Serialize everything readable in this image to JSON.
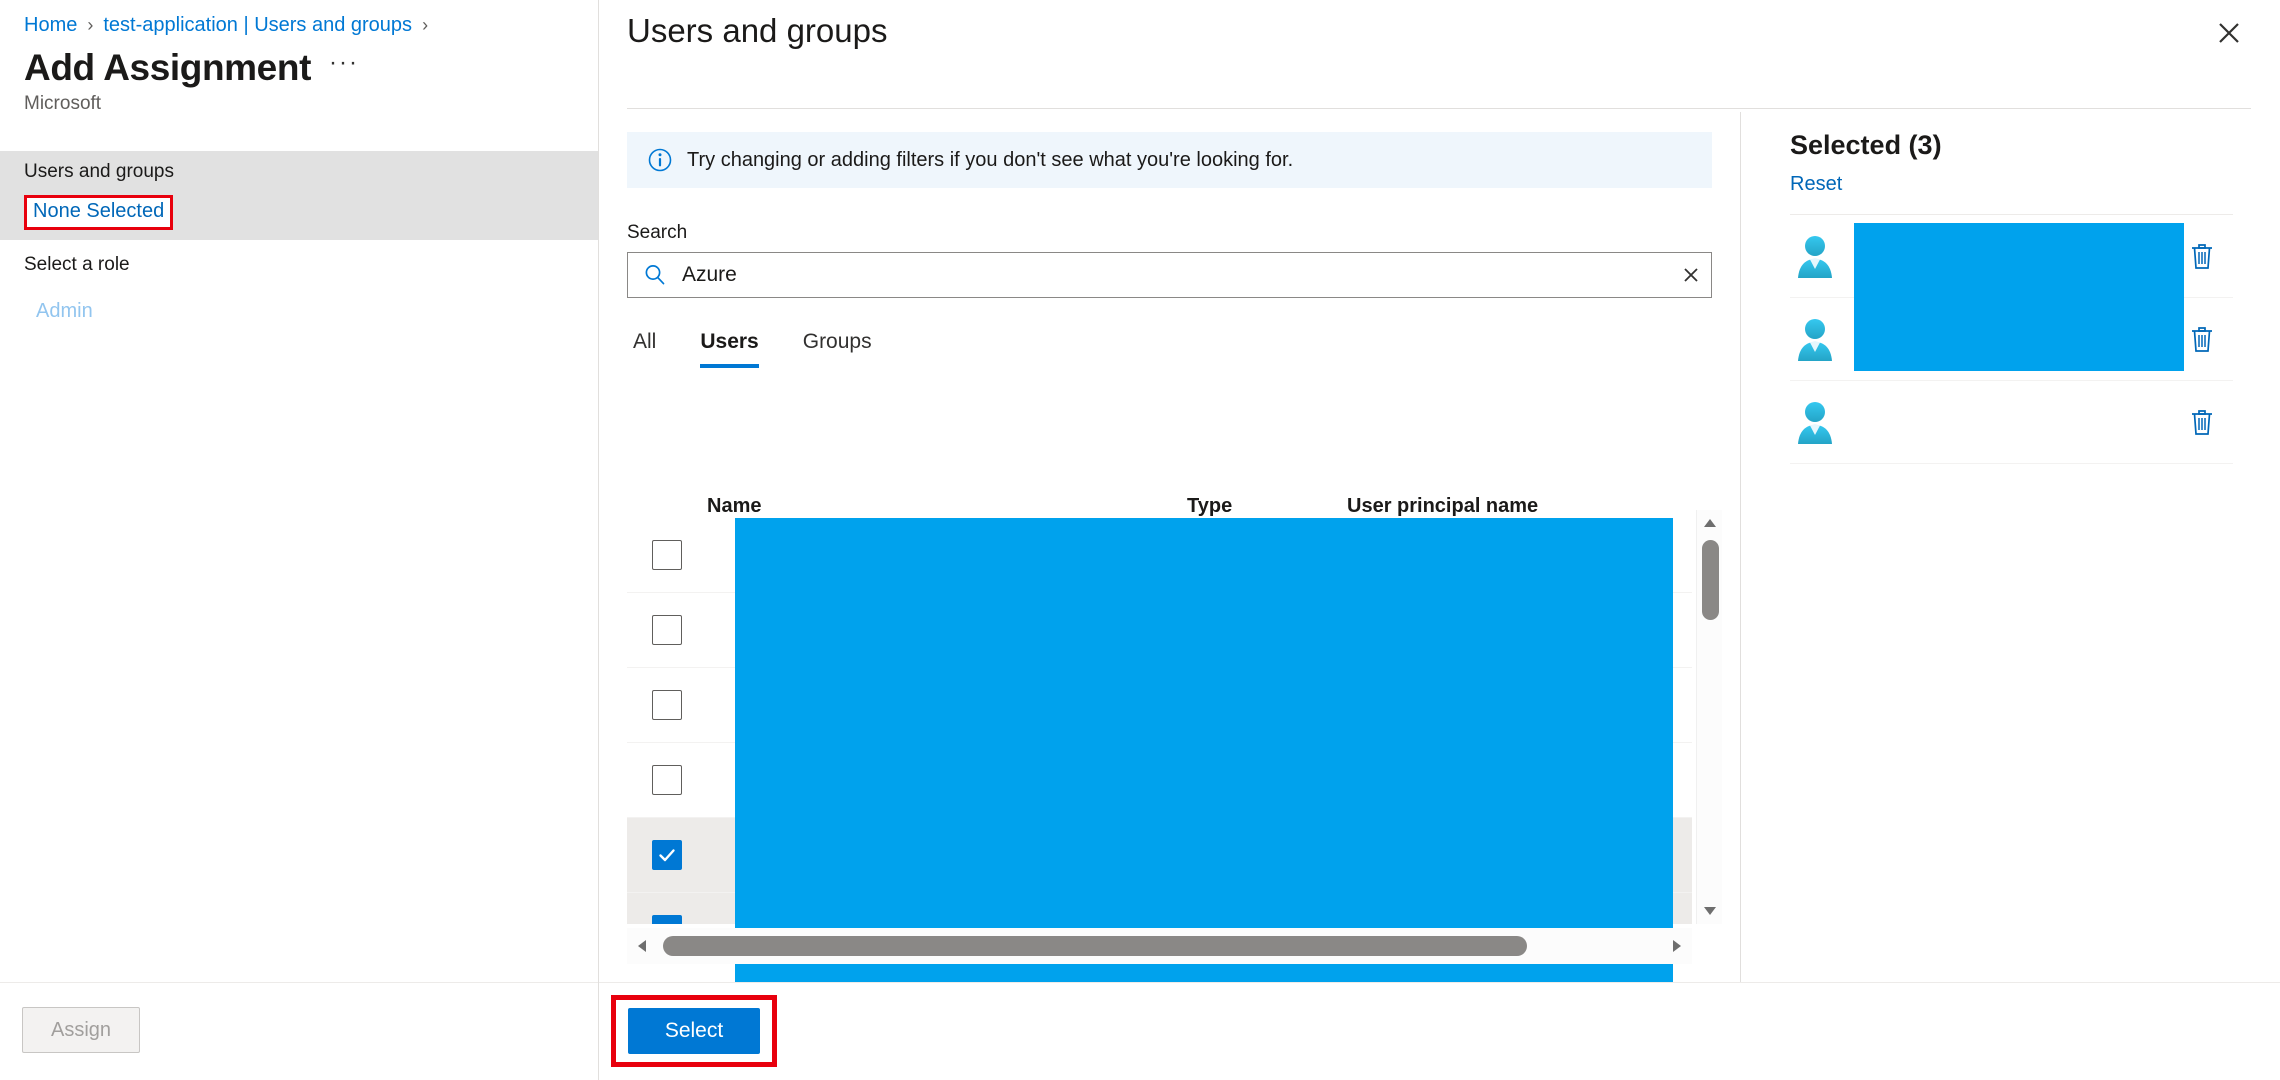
{
  "breadcrumb": {
    "items": [
      "Home",
      "test-application | Users and groups"
    ],
    "separator": "›"
  },
  "left_blade": {
    "title": "Add Assignment",
    "ellipsis": "···",
    "subtitle": "Microsoft",
    "users_groups_label": "Users and groups",
    "users_groups_value": "None Selected",
    "role_label": "Select a role",
    "role_value": "Admin",
    "assign_label": "Assign"
  },
  "pane": {
    "title": "Users and groups",
    "close_icon": "close-icon",
    "info": {
      "icon": "info-icon",
      "text": "Try changing or adding filters if you don't see what you're looking for."
    },
    "search": {
      "label": "Search",
      "icon": "search-icon",
      "value": "Azure",
      "placeholder": "Search",
      "clear_icon": "close-icon"
    },
    "tabs": [
      {
        "label": "All",
        "active": false
      },
      {
        "label": "Users",
        "active": true
      },
      {
        "label": "Groups",
        "active": false
      }
    ],
    "grid": {
      "columns": [
        "",
        "Name",
        "Type",
        "User principal name"
      ],
      "rows": [
        {
          "checked": false,
          "name": "",
          "type": "",
          "upn": ""
        },
        {
          "checked": false,
          "name": "",
          "type": "",
          "upn": ""
        },
        {
          "checked": false,
          "name": "",
          "type": "",
          "upn": ""
        },
        {
          "checked": false,
          "name": "",
          "type": "",
          "upn": ""
        },
        {
          "checked": true,
          "name": "",
          "type": "",
          "upn": ""
        },
        {
          "checked": true,
          "name": "",
          "type": "",
          "upn": ""
        },
        {
          "checked": false,
          "name": "",
          "type": "",
          "upn": ""
        }
      ],
      "vertical_scrollbar": {
        "up_icon": "chevron-up-icon",
        "down_icon": "chevron-down-icon"
      },
      "horizontal_scrollbar": {
        "left_icon": "chevron-left-icon",
        "right_icon": "chevron-right-icon"
      }
    },
    "selected": {
      "title": "Selected (3)",
      "reset_label": "Reset",
      "items": [
        {
          "avatar": "user-avatar-icon",
          "name": "",
          "delete_icon": "trash-icon"
        },
        {
          "avatar": "user-avatar-icon",
          "name": "",
          "delete_icon": "trash-icon"
        },
        {
          "avatar": "user-avatar-icon",
          "name": "",
          "delete_icon": "trash-icon"
        }
      ]
    },
    "select_button": "Select"
  },
  "colors": {
    "accent": "#0078d4",
    "link": "#0067b8",
    "highlight_box": "#e8000d",
    "redaction": "#00a2ed",
    "info_bg": "#eff6fc",
    "row_selected_bg": "#edebe9"
  }
}
